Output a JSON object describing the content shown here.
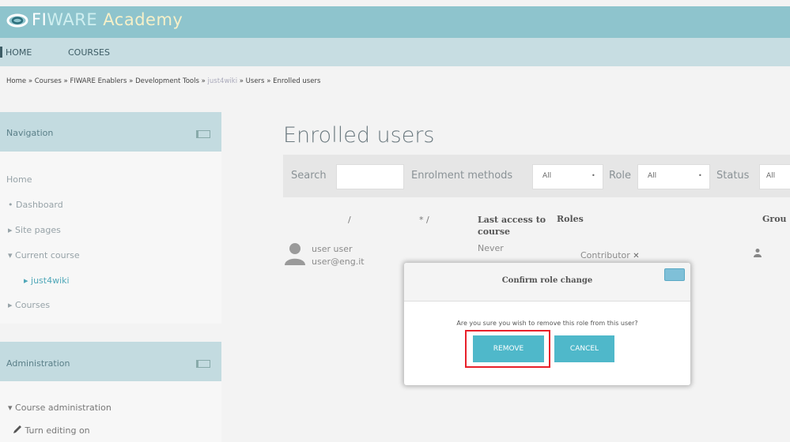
{
  "header": {
    "logo": {
      "part1": "FI",
      "part2": "WARE",
      "part3": " Academy"
    },
    "menu": {
      "home": "HOME",
      "courses": "COURSES"
    }
  },
  "breadcrumb": {
    "home": "Home",
    "courses": "Courses",
    "category": "FIWARE Enablers",
    "subcategory": "Development Tools",
    "course": "just4wiki",
    "users": "Users",
    "current": "Enrolled users",
    "sep": "»"
  },
  "navigation": {
    "title": "Navigation",
    "home": "Home",
    "items": [
      {
        "bullet": "•",
        "label": "Dashboard"
      },
      {
        "bullet": "▸",
        "label": "Site pages"
      },
      {
        "bullet": "▾",
        "label": "Current course"
      },
      {
        "bullet": "▸",
        "label": "just4wiki"
      },
      {
        "bullet": "▸",
        "label": "Courses"
      }
    ]
  },
  "administration": {
    "title": "Administration",
    "items": [
      {
        "bullet": "▾",
        "label": "Course administration"
      },
      {
        "label": "Turn editing on"
      }
    ]
  },
  "main": {
    "title": "Enrolled users",
    "filters": {
      "search_label": "Search",
      "enrolment_label": "Enrolment methods",
      "enrolment_value": "All",
      "role_label": "Role",
      "role_value": "All",
      "status_label": "Status",
      "status_value": "All"
    },
    "table": {
      "headers": {
        "firstname": "/",
        "email": "* /",
        "last_access": "Last access to course",
        "roles": "Roles",
        "groups": "Grou"
      },
      "rows": [
        {
          "name": "user user",
          "email": "user@eng.it",
          "last_access": "Never",
          "role": "Contributor",
          "role_remove": "✕"
        }
      ]
    }
  },
  "dialog": {
    "title": "Confirm role change",
    "message": "Are you sure you wish to remove this role from this user?",
    "remove": "REMOVE",
    "cancel": "CANCEL"
  },
  "colors": {
    "header": "#8ec4cd",
    "accent": "#4fb8ca",
    "highlight": "#e8202a"
  }
}
